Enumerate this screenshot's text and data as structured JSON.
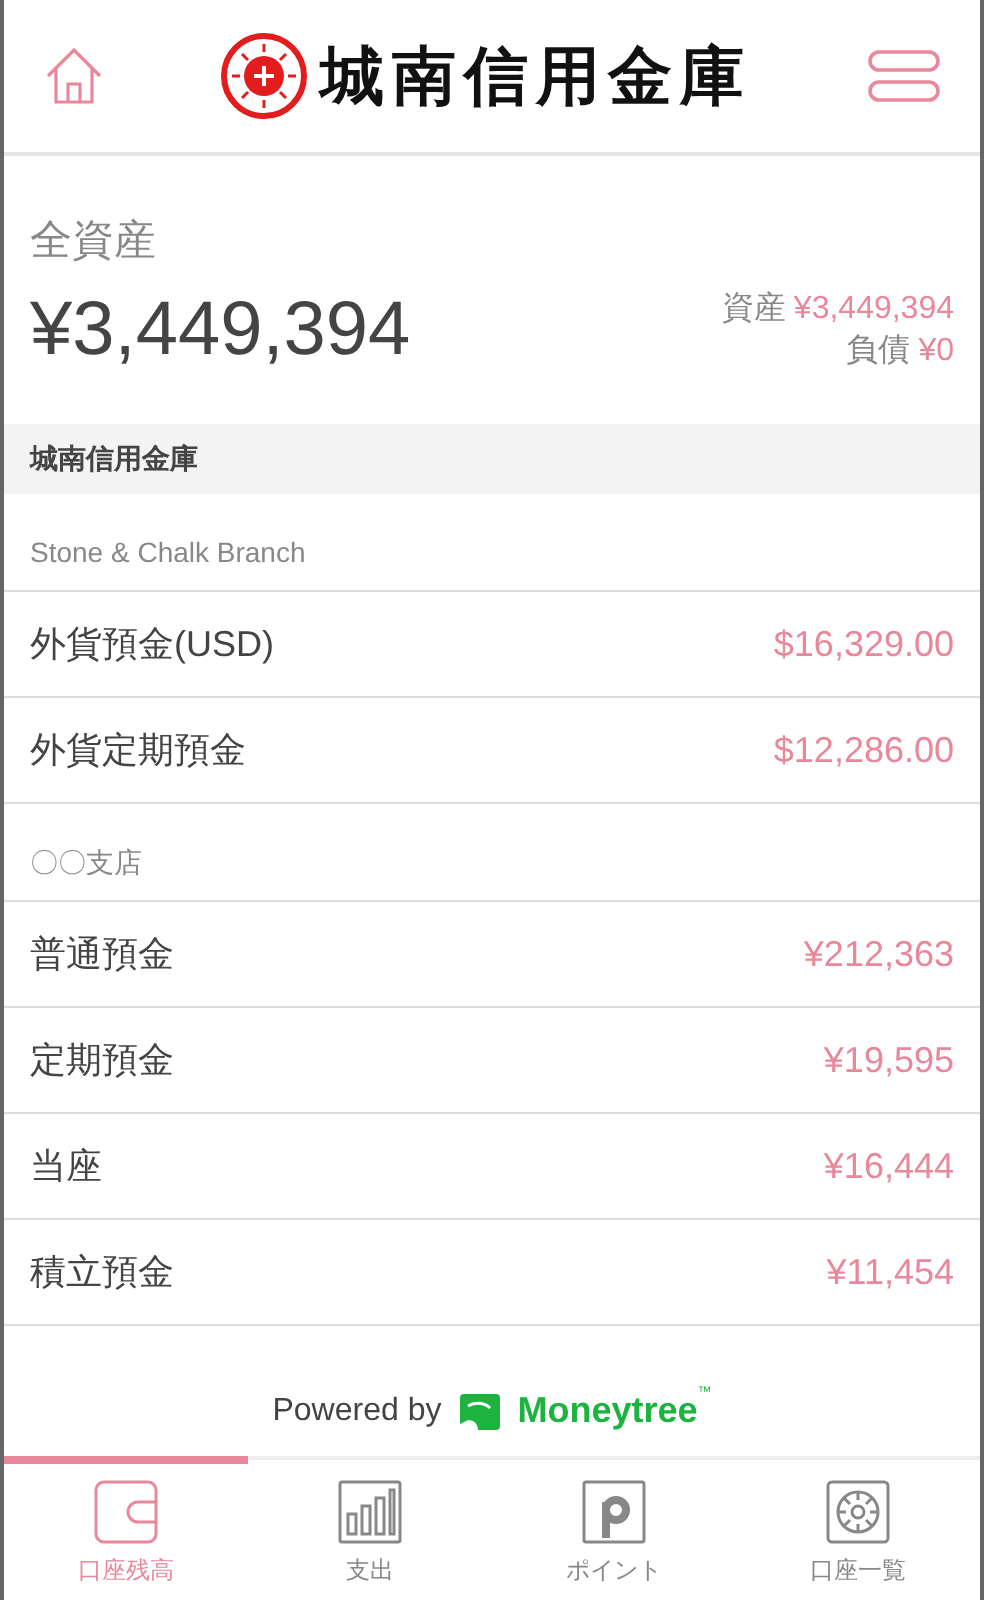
{
  "header": {
    "logo_text": "城南信用金庫"
  },
  "summary": {
    "title": "全資産",
    "total": "¥3,449,394",
    "assets_label": "資産",
    "assets": "¥3,449,394",
    "liabilities_label": "負債",
    "liabilities": "¥0"
  },
  "institution": "城南信用金庫",
  "branches": [
    {
      "name": "Stone & Chalk Branch",
      "accounts": [
        {
          "name": "外貨預金(USD)",
          "balance": "$16,329.00"
        },
        {
          "name": "外貨定期預金",
          "balance": "$12,286.00"
        }
      ]
    },
    {
      "name": "〇〇支店",
      "accounts": [
        {
          "name": "普通預金",
          "balance": "¥212,363"
        },
        {
          "name": "定期預金",
          "balance": "¥19,595"
        },
        {
          "name": "当座",
          "balance": "¥16,444"
        },
        {
          "name": "積立預金",
          "balance": "¥11,454"
        }
      ]
    }
  ],
  "footer": {
    "powered_by": "Powered by",
    "brand": "Moneytree",
    "trademark": "™"
  },
  "tabs": [
    {
      "label": "口座残高",
      "kind": "wallet",
      "selected": true
    },
    {
      "label": "支出",
      "kind": "chart",
      "selected": false
    },
    {
      "label": "ポイント",
      "kind": "points",
      "selected": false
    },
    {
      "label": "口座一覧",
      "kind": "safe",
      "selected": false
    }
  ]
}
